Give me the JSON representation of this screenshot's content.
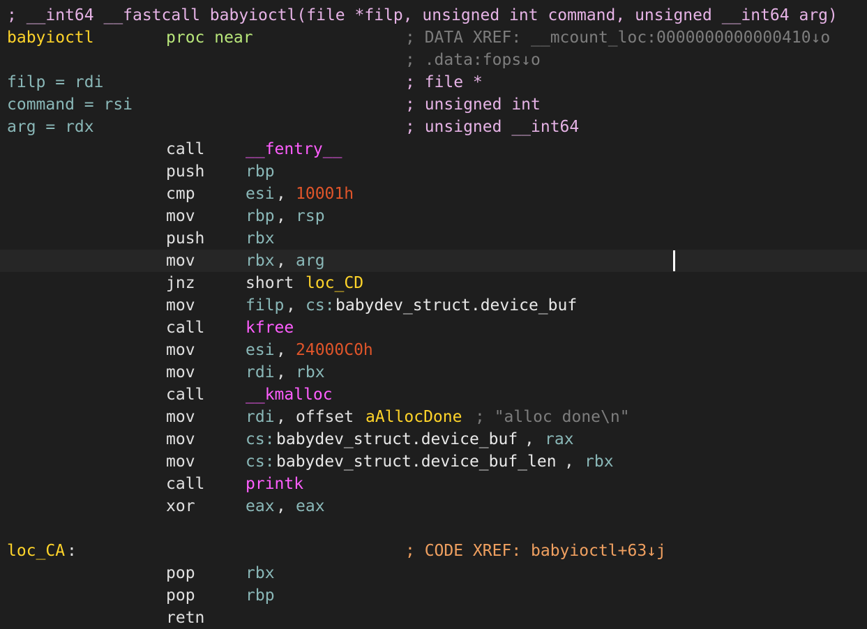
{
  "listing": {
    "lines": [
      {
        "current": false,
        "segs": [
          {
            "col": 0,
            "text": "; __int64 __fastcall babyioctl(file *filp, unsigned int command, unsigned __int64 arg)",
            "cls": "c-cmtpink",
            "name": "function-prototype-comment",
            "interactable": false
          }
        ]
      },
      {
        "current": false,
        "segs": [
          {
            "col": 0,
            "text": "babyioctl",
            "cls": "c-label",
            "name": "function-name-label",
            "interactable": true
          },
          {
            "col": 8,
            "text": "proc near",
            "cls": "c-kw",
            "name": "proc-directive",
            "interactable": false
          },
          {
            "col": 20,
            "text": "; DATA XREF: __mcount_loc:0000000000000410↓o",
            "cls": "c-cmt",
            "name": "xref-comment",
            "interactable": true
          }
        ]
      },
      {
        "current": false,
        "segs": [
          {
            "col": 20,
            "text": "; .data:fops↓o",
            "cls": "c-cmt",
            "name": "xref-comment",
            "interactable": true
          }
        ]
      },
      {
        "current": false,
        "segs": [
          {
            "col": 0,
            "text": "filp = rdi",
            "cls": "c-var",
            "name": "arg-var-definition",
            "interactable": true
          },
          {
            "col": 20,
            "text": "; file *",
            "cls": "c-cmtpink",
            "name": "type-comment",
            "interactable": false
          }
        ]
      },
      {
        "current": false,
        "segs": [
          {
            "col": 0,
            "text": "command = rsi",
            "cls": "c-var",
            "name": "arg-var-definition",
            "interactable": true
          },
          {
            "col": 20,
            "text": "; unsigned int",
            "cls": "c-cmtpink",
            "name": "type-comment",
            "interactable": false
          }
        ]
      },
      {
        "current": false,
        "segs": [
          {
            "col": 0,
            "text": "arg = rdx",
            "cls": "c-var",
            "name": "arg-var-definition",
            "interactable": true
          },
          {
            "col": 20,
            "text": "; unsigned __int64",
            "cls": "c-cmtpink",
            "name": "type-comment",
            "interactable": false
          }
        ]
      },
      {
        "current": false,
        "segs": [
          {
            "col": 8,
            "text": "call",
            "cls": "c-mnem",
            "name": "instruction-mnemonic",
            "interactable": false
          },
          {
            "col": 12,
            "text": "__fentry__",
            "cls": "c-func",
            "name": "call-target",
            "interactable": true
          }
        ]
      },
      {
        "current": false,
        "segs": [
          {
            "col": 8,
            "text": "push",
            "cls": "c-mnem",
            "name": "instruction-mnemonic",
            "interactable": false
          },
          {
            "col": 12,
            "text": "rbp",
            "cls": "c-reg",
            "name": "register-operand",
            "interactable": true
          }
        ]
      },
      {
        "current": false,
        "segs": [
          {
            "col": 8,
            "text": "cmp",
            "cls": "c-mnem",
            "name": "instruction-mnemonic",
            "interactable": false
          },
          {
            "col": 12,
            "text": "esi",
            "cls": "c-reg",
            "name": "register-operand",
            "interactable": true
          },
          {
            "col": 15,
            "text": ", ",
            "cls": "c-default",
            "name": "operand-separator",
            "interactable": false
          },
          {
            "col": 17,
            "text": "10001h",
            "cls": "c-num",
            "name": "immediate-operand",
            "interactable": true
          }
        ]
      },
      {
        "current": false,
        "segs": [
          {
            "col": 8,
            "text": "mov",
            "cls": "c-mnem",
            "name": "instruction-mnemonic",
            "interactable": false
          },
          {
            "col": 12,
            "text": "rbp",
            "cls": "c-reg",
            "name": "register-operand",
            "interactable": true
          },
          {
            "col": 15,
            "text": ", ",
            "cls": "c-default",
            "name": "operand-separator",
            "interactable": false
          },
          {
            "col": 17,
            "text": "rsp",
            "cls": "c-reg",
            "name": "register-operand",
            "interactable": true
          }
        ]
      },
      {
        "current": false,
        "segs": [
          {
            "col": 8,
            "text": "push",
            "cls": "c-mnem",
            "name": "instruction-mnemonic",
            "interactable": false
          },
          {
            "col": 12,
            "text": "rbx",
            "cls": "c-reg",
            "name": "register-operand",
            "interactable": true
          }
        ]
      },
      {
        "current": true,
        "segs": [
          {
            "col": 8,
            "text": "mov",
            "cls": "c-mnem",
            "name": "instruction-mnemonic",
            "interactable": false
          },
          {
            "col": 12,
            "text": "rbx",
            "cls": "c-reg",
            "name": "register-operand",
            "interactable": true
          },
          {
            "col": 15,
            "text": ", ",
            "cls": "c-default",
            "name": "operand-separator",
            "interactable": false
          },
          {
            "col": 17,
            "text": "arg",
            "cls": "c-var",
            "name": "variable-operand",
            "interactable": true
          }
        ]
      },
      {
        "current": false,
        "segs": [
          {
            "col": 8,
            "text": "jnz",
            "cls": "c-mnem",
            "name": "instruction-mnemonic",
            "interactable": false
          },
          {
            "col": 12,
            "text": "short",
            "cls": "c-default",
            "name": "jump-size-keyword",
            "interactable": false
          },
          {
            "col": 18,
            "text": "loc_CD",
            "cls": "c-sym",
            "name": "jump-target-label",
            "interactable": true
          }
        ]
      },
      {
        "current": false,
        "segs": [
          {
            "col": 8,
            "text": "mov",
            "cls": "c-mnem",
            "name": "instruction-mnemonic",
            "interactable": false
          },
          {
            "col": 12,
            "text": "filp",
            "cls": "c-var",
            "name": "variable-operand",
            "interactable": true
          },
          {
            "col": 16,
            "text": ", ",
            "cls": "c-default",
            "name": "operand-separator",
            "interactable": false
          },
          {
            "col": 18,
            "text": "cs:",
            "cls": "c-ptr",
            "name": "segment-prefix",
            "interactable": false
          },
          {
            "col": 21,
            "text": "babydev_struct.device_buf",
            "cls": "c-white",
            "name": "memory-operand",
            "interactable": true
          }
        ]
      },
      {
        "current": false,
        "segs": [
          {
            "col": 8,
            "text": "call",
            "cls": "c-mnem",
            "name": "instruction-mnemonic",
            "interactable": false
          },
          {
            "col": 12,
            "text": "kfree",
            "cls": "c-func",
            "name": "call-target",
            "interactable": true
          }
        ]
      },
      {
        "current": false,
        "segs": [
          {
            "col": 8,
            "text": "mov",
            "cls": "c-mnem",
            "name": "instruction-mnemonic",
            "interactable": false
          },
          {
            "col": 12,
            "text": "esi",
            "cls": "c-reg",
            "name": "register-operand",
            "interactable": true
          },
          {
            "col": 15,
            "text": ", ",
            "cls": "c-default",
            "name": "operand-separator",
            "interactable": false
          },
          {
            "col": 17,
            "text": "24000C0h",
            "cls": "c-num",
            "name": "immediate-operand",
            "interactable": true
          }
        ]
      },
      {
        "current": false,
        "segs": [
          {
            "col": 8,
            "text": "mov",
            "cls": "c-mnem",
            "name": "instruction-mnemonic",
            "interactable": false
          },
          {
            "col": 12,
            "text": "rdi",
            "cls": "c-reg",
            "name": "register-operand",
            "interactable": true
          },
          {
            "col": 15,
            "text": ", ",
            "cls": "c-default",
            "name": "operand-separator",
            "interactable": false
          },
          {
            "col": 17,
            "text": "rbx",
            "cls": "c-reg",
            "name": "register-operand",
            "interactable": true
          }
        ]
      },
      {
        "current": false,
        "segs": [
          {
            "col": 8,
            "text": "call",
            "cls": "c-mnem",
            "name": "instruction-mnemonic",
            "interactable": false
          },
          {
            "col": 12,
            "text": "__kmalloc",
            "cls": "c-func",
            "name": "call-target",
            "interactable": true
          }
        ]
      },
      {
        "current": false,
        "segs": [
          {
            "col": 8,
            "text": "mov",
            "cls": "c-mnem",
            "name": "instruction-mnemonic",
            "interactable": false
          },
          {
            "col": 12,
            "text": "rdi",
            "cls": "c-reg",
            "name": "register-operand",
            "interactable": true
          },
          {
            "col": 15,
            "text": ", ",
            "cls": "c-default",
            "name": "operand-separator",
            "interactable": false
          },
          {
            "col": 17,
            "text": "offset",
            "cls": "c-default",
            "name": "offset-keyword",
            "interactable": false
          },
          {
            "col": 24,
            "text": "aAllocDone",
            "cls": "c-sym",
            "name": "string-symbol-operand",
            "interactable": true
          },
          {
            "col": 35,
            "text": "; \"alloc done\\n\"",
            "cls": "c-str",
            "name": "string-comment",
            "interactable": false
          }
        ]
      },
      {
        "current": false,
        "segs": [
          {
            "col": 8,
            "text": "mov",
            "cls": "c-mnem",
            "name": "instruction-mnemonic",
            "interactable": false
          },
          {
            "col": 12,
            "text": "cs:",
            "cls": "c-ptr",
            "name": "segment-prefix",
            "interactable": false
          },
          {
            "col": 15,
            "text": "babydev_struct.device_buf",
            "cls": "c-white",
            "name": "memory-operand",
            "interactable": true
          },
          {
            "col": 40,
            "text": ", ",
            "cls": "c-default",
            "name": "operand-separator",
            "interactable": false
          },
          {
            "col": 42,
            "text": "rax",
            "cls": "c-reg",
            "name": "register-operand",
            "interactable": true
          }
        ]
      },
      {
        "current": false,
        "segs": [
          {
            "col": 8,
            "text": "mov",
            "cls": "c-mnem",
            "name": "instruction-mnemonic",
            "interactable": false
          },
          {
            "col": 12,
            "text": "cs:",
            "cls": "c-ptr",
            "name": "segment-prefix",
            "interactable": false
          },
          {
            "col": 15,
            "text": "babydev_struct.device_buf_len",
            "cls": "c-white",
            "name": "memory-operand",
            "interactable": true
          },
          {
            "col": 44,
            "text": ", ",
            "cls": "c-default",
            "name": "operand-separator",
            "interactable": false
          },
          {
            "col": 46,
            "text": "rbx",
            "cls": "c-reg",
            "name": "register-operand",
            "interactable": true
          }
        ]
      },
      {
        "current": false,
        "segs": [
          {
            "col": 8,
            "text": "call",
            "cls": "c-mnem",
            "name": "instruction-mnemonic",
            "interactable": false
          },
          {
            "col": 12,
            "text": "printk",
            "cls": "c-func",
            "name": "call-target",
            "interactable": true
          }
        ]
      },
      {
        "current": false,
        "segs": [
          {
            "col": 8,
            "text": "xor",
            "cls": "c-mnem",
            "name": "instruction-mnemonic",
            "interactable": false
          },
          {
            "col": 12,
            "text": "eax",
            "cls": "c-reg",
            "name": "register-operand",
            "interactable": true
          },
          {
            "col": 15,
            "text": ", ",
            "cls": "c-default",
            "name": "operand-separator",
            "interactable": false
          },
          {
            "col": 17,
            "text": "eax",
            "cls": "c-reg",
            "name": "register-operand",
            "interactable": true
          }
        ]
      },
      {
        "current": false,
        "segs": []
      },
      {
        "current": false,
        "segs": [
          {
            "col": 0,
            "text": "loc_CA",
            "cls": "c-label",
            "name": "location-label",
            "interactable": true
          },
          {
            "col": 6,
            "text": ":",
            "cls": "c-default",
            "name": "label-colon",
            "interactable": false
          },
          {
            "col": 20,
            "text": "; CODE XREF: babyioctl+63↓j",
            "cls": "c-cmtorng",
            "name": "code-xref-comment",
            "interactable": true
          }
        ]
      },
      {
        "current": false,
        "segs": [
          {
            "col": 8,
            "text": "pop",
            "cls": "c-mnem",
            "name": "instruction-mnemonic",
            "interactable": false
          },
          {
            "col": 12,
            "text": "rbx",
            "cls": "c-reg",
            "name": "register-operand",
            "interactable": true
          }
        ]
      },
      {
        "current": false,
        "segs": [
          {
            "col": 8,
            "text": "pop",
            "cls": "c-mnem",
            "name": "instruction-mnemonic",
            "interactable": false
          },
          {
            "col": 12,
            "text": "rbp",
            "cls": "c-reg",
            "name": "register-operand",
            "interactable": true
          }
        ]
      },
      {
        "current": false,
        "segs": [
          {
            "col": 8,
            "text": "retn",
            "cls": "c-mnem",
            "name": "instruction-mnemonic",
            "interactable": false
          }
        ]
      }
    ]
  }
}
